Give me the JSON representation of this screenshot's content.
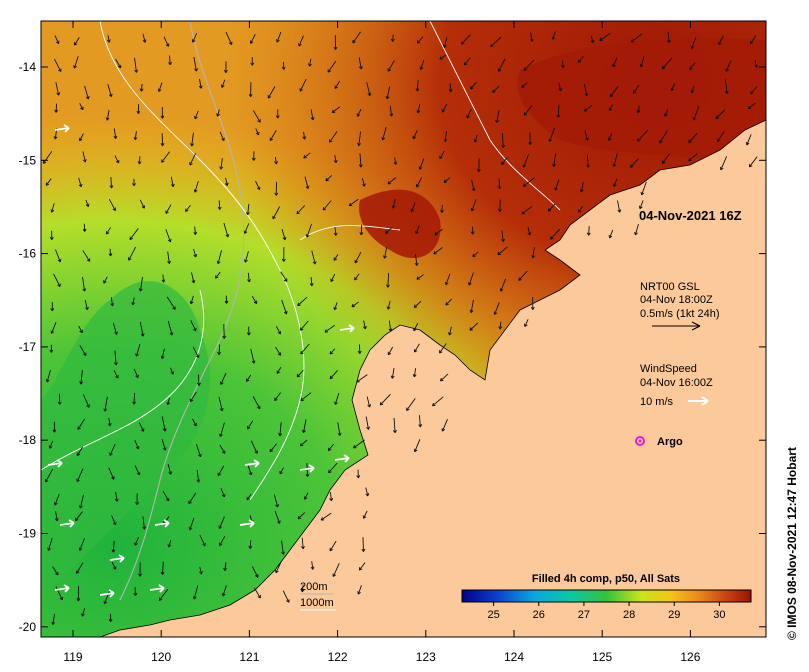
{
  "title_time": "04-Nov-2021 16Z",
  "legend": {
    "current_title": "NRT00 GSL",
    "current_time": "04-Nov 18:00Z",
    "current_scale": "0.5m/s (1kt 24h)",
    "wind_title": "WindSpeed",
    "wind_time": "04-Nov 16:00Z",
    "wind_scale": "10 m/s",
    "argo_label": "Argo"
  },
  "axes": {
    "lat_ticks": [
      "-14",
      "-15",
      "-16",
      "-17",
      "-18",
      "-19",
      "-20"
    ],
    "lon_ticks": [
      "119",
      "120",
      "121",
      "122",
      "123",
      "124",
      "125",
      "126"
    ]
  },
  "contours": {
    "label_200": "200m",
    "label_1000": "1000m"
  },
  "colorbar": {
    "title": "Filled 4h comp, p50, All Sats",
    "ticks": [
      "25",
      "26",
      "27",
      "28",
      "29",
      "30"
    ],
    "range": [
      24.3,
      30.7
    ]
  },
  "credit": "© IMOS 08-Nov-2021 12:47 Hobart",
  "colors": {
    "land": "#fbc99a",
    "warm": "#e2921c",
    "hot": "#a41a06",
    "cool": "#2ec04a"
  }
}
